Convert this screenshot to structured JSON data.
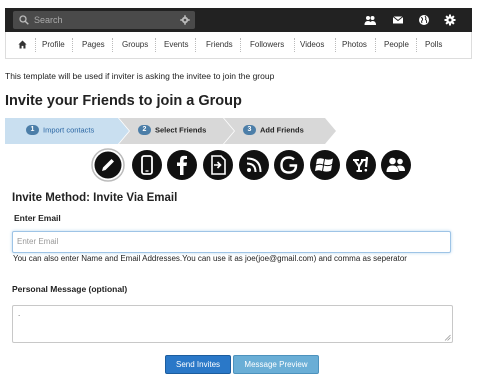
{
  "search": {
    "placeholder": "Search",
    "icon": "search-icon",
    "settings_icon": "gear-icon"
  },
  "top_icons": [
    "friend-requests-icon",
    "messages-icon",
    "globe-icon",
    "settings-gear-icon"
  ],
  "nav": {
    "home_icon": "home-icon",
    "items": [
      "Profile",
      "Pages",
      "Groups",
      "Events",
      "Friends",
      "Followers",
      "Videos",
      "Photos",
      "People",
      "Polls"
    ]
  },
  "note": "This template will be used if inviter is asking the invitee to join the group",
  "title": "Invite your Friends to join a Group",
  "steps": [
    {
      "num": "1",
      "label": "Import contacts",
      "active": true
    },
    {
      "num": "2",
      "label": "Select Friends",
      "active": false
    },
    {
      "num": "3",
      "label": "Add Friends",
      "active": false
    }
  ],
  "methods": [
    "pencil-icon",
    "phone-icon",
    "facebook-icon",
    "import-file-icon",
    "rss-icon",
    "google-icon",
    "windows-icon",
    "yahoo-icon",
    "users-icon"
  ],
  "form": {
    "method_title": "Invite Method: Invite Via Email",
    "email_label": "Enter Email",
    "email_placeholder": "Enter Email",
    "email_help": "You can also enter Name and Email Addresses.You can use it as joe(joe@gmail.com) and comma as seperator",
    "message_label": "Personal Message (optional)",
    "message_value": "."
  },
  "buttons": {
    "send": "Send Invites",
    "preview": "Message Preview"
  },
  "colors": {
    "topbar": "#222222",
    "step_active": "#c9dff0",
    "step_inactive": "#d8d8d8",
    "send_button": "#2a78c8",
    "preview_button": "#6aaed6"
  }
}
